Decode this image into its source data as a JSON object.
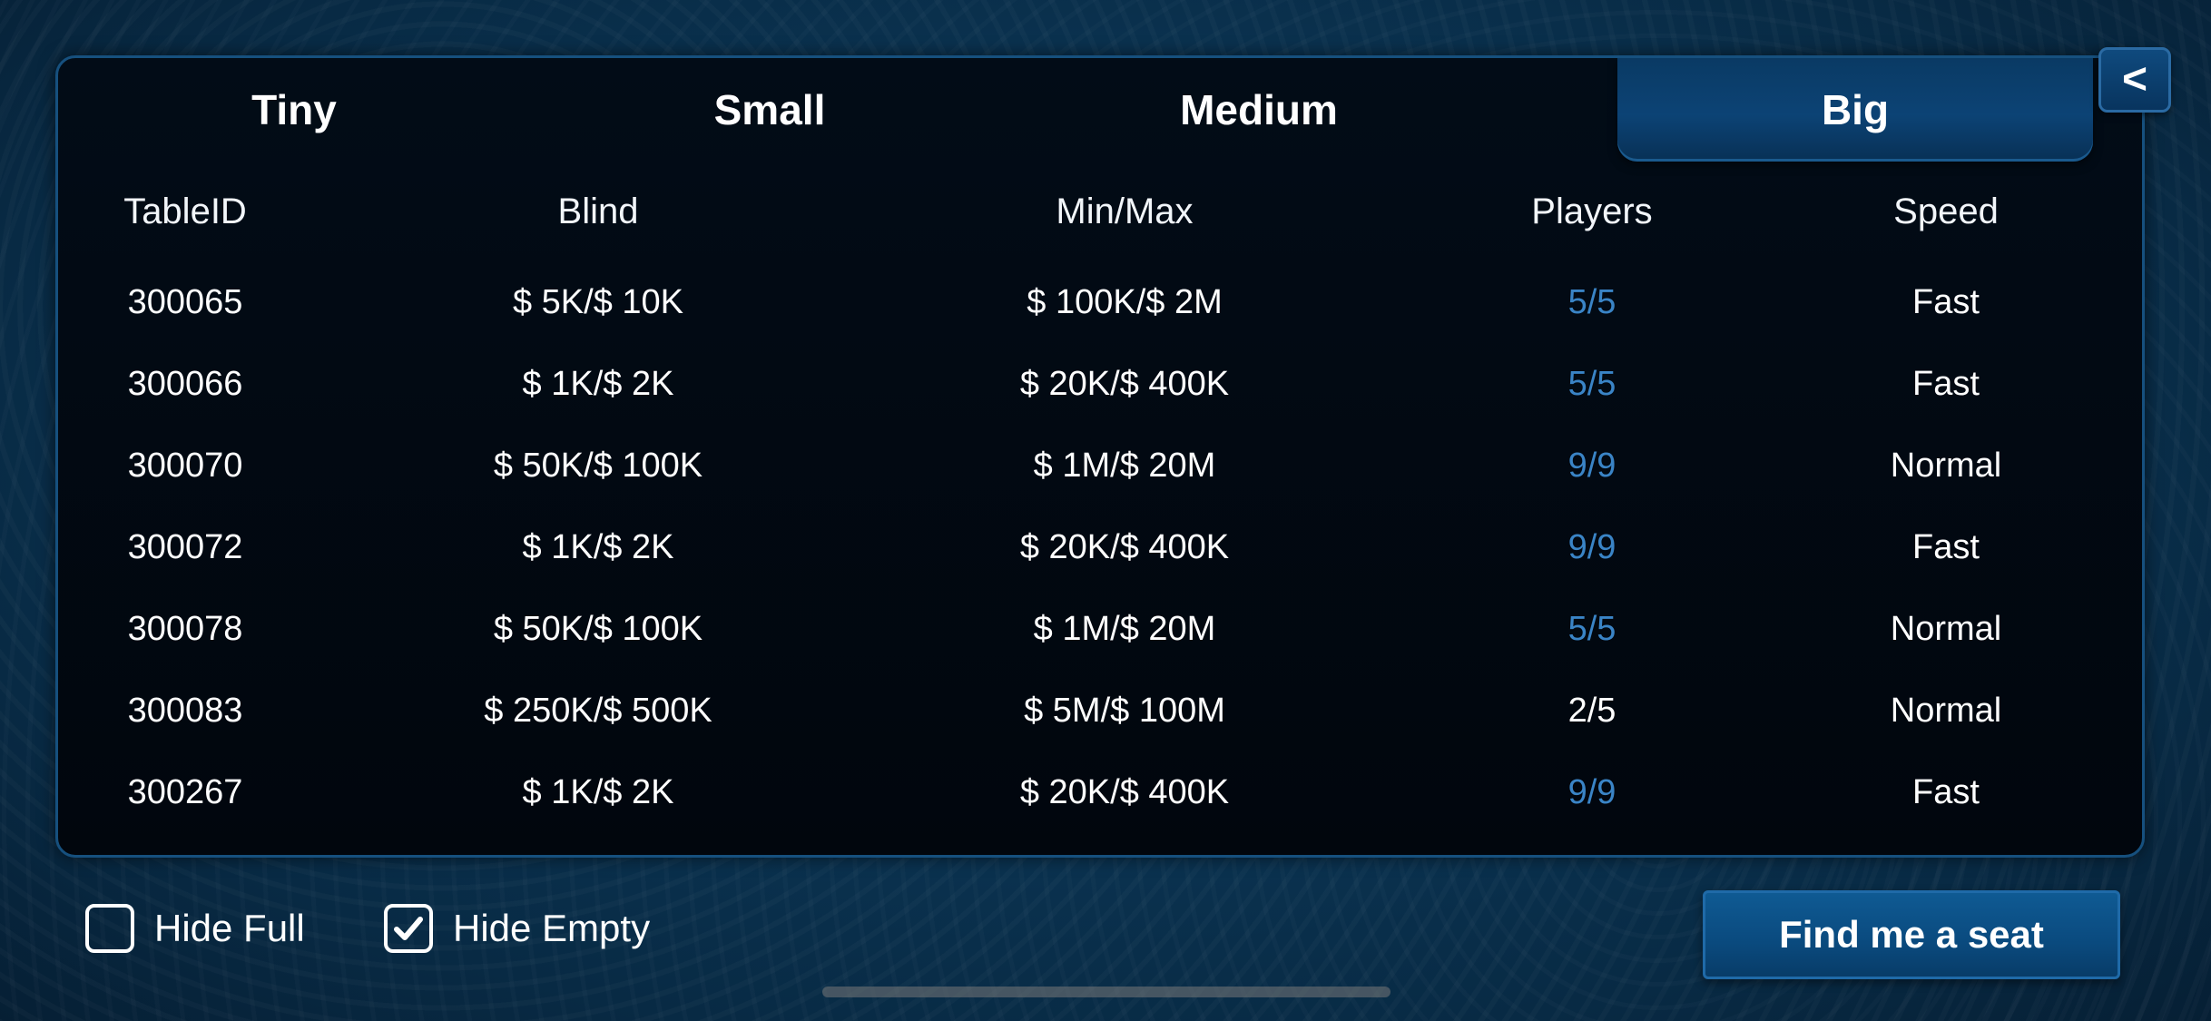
{
  "tabs": [
    {
      "label": "Tiny",
      "selected": false
    },
    {
      "label": "Small",
      "selected": false
    },
    {
      "label": "Medium",
      "selected": false
    },
    {
      "label": "Big",
      "selected": true
    }
  ],
  "back_button": {
    "label": "<"
  },
  "table": {
    "columns": [
      "TableID",
      "Blind",
      "Min/Max",
      "Players",
      "Speed"
    ],
    "rows": [
      {
        "id": "300065",
        "blind": "$ 5K/$ 10K",
        "minmax": "$ 100K/$ 2M",
        "players": "5/5",
        "speed": "Fast"
      },
      {
        "id": "300066",
        "blind": "$ 1K/$ 2K",
        "minmax": "$ 20K/$ 400K",
        "players": "5/5",
        "speed": "Fast"
      },
      {
        "id": "300070",
        "blind": "$ 50K/$ 100K",
        "minmax": "$ 1M/$ 20M",
        "players": "9/9",
        "speed": "Normal"
      },
      {
        "id": "300072",
        "blind": "$ 1K/$ 2K",
        "minmax": "$ 20K/$ 400K",
        "players": "9/9",
        "speed": "Fast"
      },
      {
        "id": "300078",
        "blind": "$ 50K/$ 100K",
        "minmax": "$ 1M/$ 20M",
        "players": "5/5",
        "speed": "Normal"
      },
      {
        "id": "300083",
        "blind": "$ 250K/$ 500K",
        "minmax": "$ 5M/$ 100M",
        "players": "2/5",
        "speed": "Normal"
      },
      {
        "id": "300267",
        "blind": "$ 1K/$ 2K",
        "minmax": "$ 20K/$ 400K",
        "players": "9/9",
        "speed": "Fast"
      }
    ]
  },
  "filters": {
    "hide_full": {
      "label": "Hide Full",
      "checked": false
    },
    "hide_empty": {
      "label": "Hide Empty",
      "checked": true
    }
  },
  "find_seat_button": {
    "label": "Find me a seat"
  },
  "colors": {
    "full_table_players": "#3a84c6",
    "open_table_players": "#ffffff",
    "accent": "#0c4375"
  }
}
